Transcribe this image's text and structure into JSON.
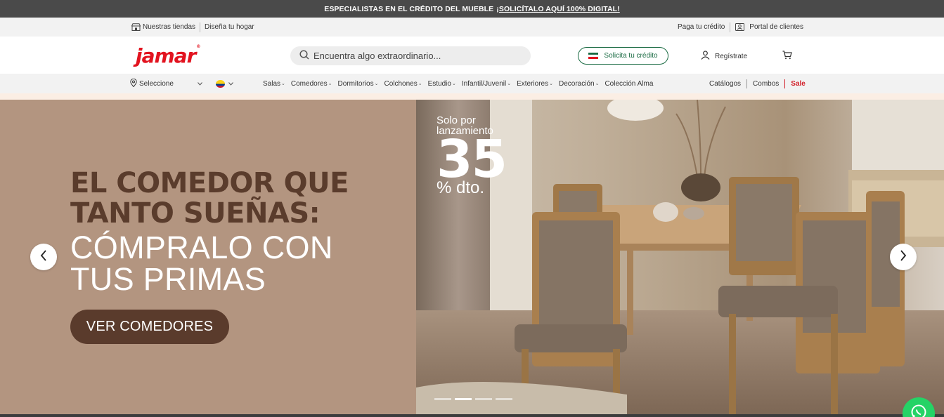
{
  "topbar": {
    "text": "ESPECIALISTAS EN EL CRÉDITO DEL MUEBLE",
    "link": "¡SOLICÍTALO AQUÍ 100% DIGITAL!"
  },
  "utility": {
    "stores": "Nuestras tiendas",
    "design": "Diseña tu hogar",
    "pay_credit": "Paga tu crédito",
    "client_portal": "Portal de clientes"
  },
  "header": {
    "logo": "Jamar",
    "search_placeholder": "Encuentra algo extraordinario...",
    "credit_button": "Solicita tu crédito",
    "register": "Regístrate"
  },
  "nav": {
    "location": "Seleccione",
    "menu": [
      "Salas",
      "Comedores",
      "Dormitorios",
      "Colchones",
      "Estudio",
      "Infantil/Juvenil",
      "Exteriores",
      "Decoración"
    ],
    "collection": "Colección Alma",
    "catalogs": "Catálogos",
    "combos": "Combos",
    "sale": "Sale"
  },
  "hero": {
    "headline_line1": "EL COMEDOR QUE",
    "headline_line2": "TANTO SUEÑAS:",
    "subline1": "CÓMPRALO CON",
    "subline2": "TUS PRIMAS",
    "cta": "VER COMEDORES",
    "promo_small1": "Solo por",
    "promo_small2": "lanzamiento",
    "promo_number": "35",
    "promo_suffix": "% dto.",
    "slides": 4,
    "active_slide": 2
  },
  "colors": {
    "brand_red": "#e2131f",
    "credit_green": "#1a6b43",
    "cta_brown": "#5a3b2c",
    "hero_left_bg": "#b39580",
    "sale_red": "#d2202a"
  }
}
